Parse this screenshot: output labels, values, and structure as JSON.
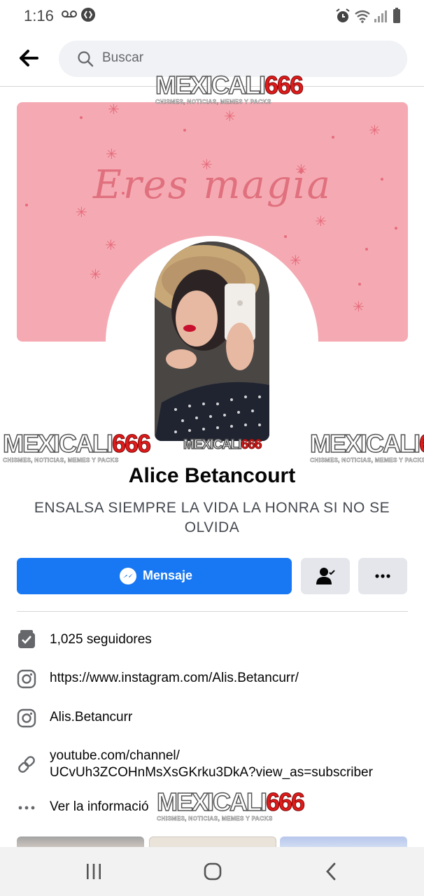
{
  "status_bar": {
    "time": "1:16",
    "voicemail_icon": "voicemail-icon",
    "shazam_icon": "shazam-icon",
    "right_icons": [
      "alarm-icon",
      "wifi-icon",
      "signal-icon",
      "battery-icon"
    ]
  },
  "header": {
    "back_icon": "back-arrow-icon",
    "search_icon": "search-icon",
    "search_placeholder": "Buscar"
  },
  "cover": {
    "text": "Eres magia",
    "color": "#f5aab3"
  },
  "watermark": {
    "part1": "MEXICALI",
    "part2": "666",
    "tagline": "CHISMES, NOTICIAS, MEMES Y PACKS"
  },
  "profile": {
    "name": "Alice Betancourt",
    "bio": "ENSALSA SIEMPRE LA VIDA LA HONRA SI NO SE OLVIDA"
  },
  "actions": {
    "message_label": "Mensaje",
    "message_icon": "messenger-icon",
    "friend_icon": "friend-check-icon",
    "more_icon": "more-dots-icon",
    "accent": "#1877f2"
  },
  "info": {
    "followers": "1,025 seguidores",
    "instagram_url": "https://www.instagram.com/Alis.Betancurr/",
    "instagram_user": "Alis.Betancurr",
    "youtube_line1": "youtube.com/channel/",
    "youtube_line2": "UCvUh3ZCOHnMsXsGKrku3DkA?view_as=subscriber",
    "more_info": "Ver la informació"
  },
  "nav": {
    "recents_icon": "recents-icon",
    "home_icon": "home-icon",
    "back_icon": "nav-back-icon"
  }
}
